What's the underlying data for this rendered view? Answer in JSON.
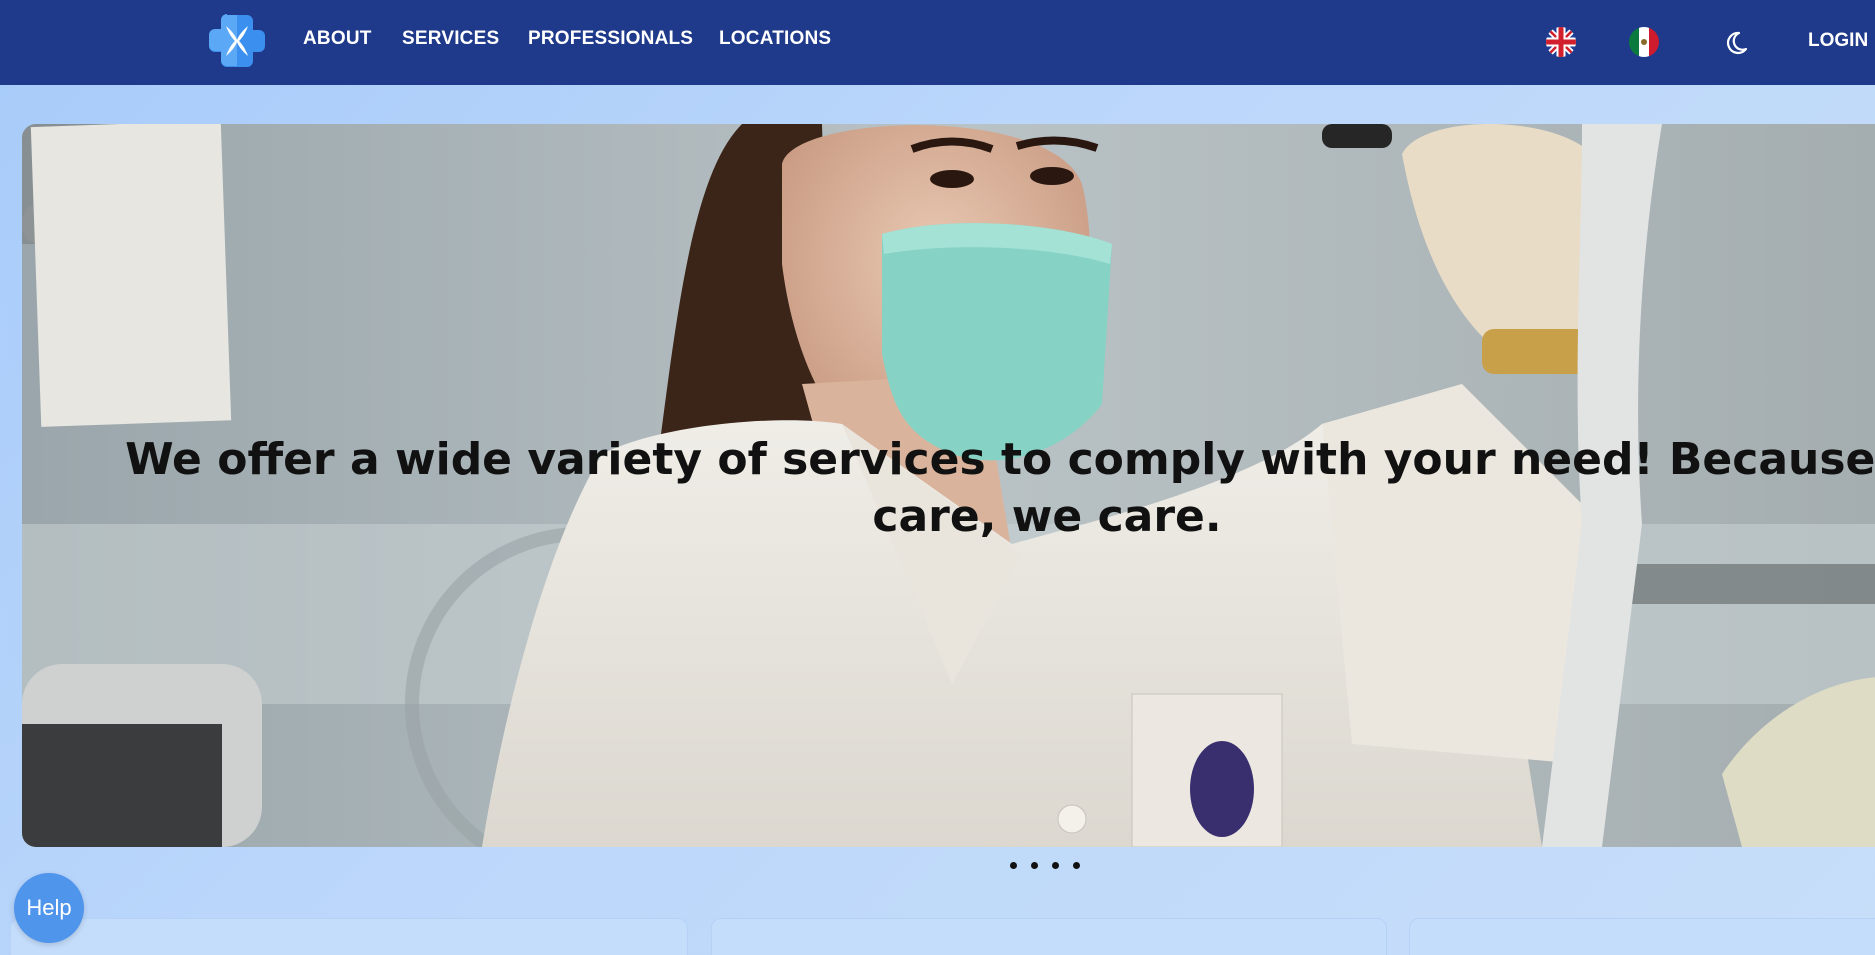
{
  "nav": {
    "links": [
      "ABOUT",
      "SERVICES",
      "PROFESSIONALS",
      "LOCATIONS"
    ],
    "login_label": "LOGIN",
    "languages": [
      "english-flag-icon",
      "mexico-flag-icon"
    ],
    "theme_toggle_icon": "moon-icon",
    "background": "#1f3a8a"
  },
  "hero": {
    "caption_line1": "We offer a wide variety of services to comply with your need! Because if y",
    "caption_line2": "care, we care.",
    "slide_count": 4
  },
  "help": {
    "label": "Help",
    "color": "#4f95ec"
  },
  "cards": {
    "count": 3
  }
}
